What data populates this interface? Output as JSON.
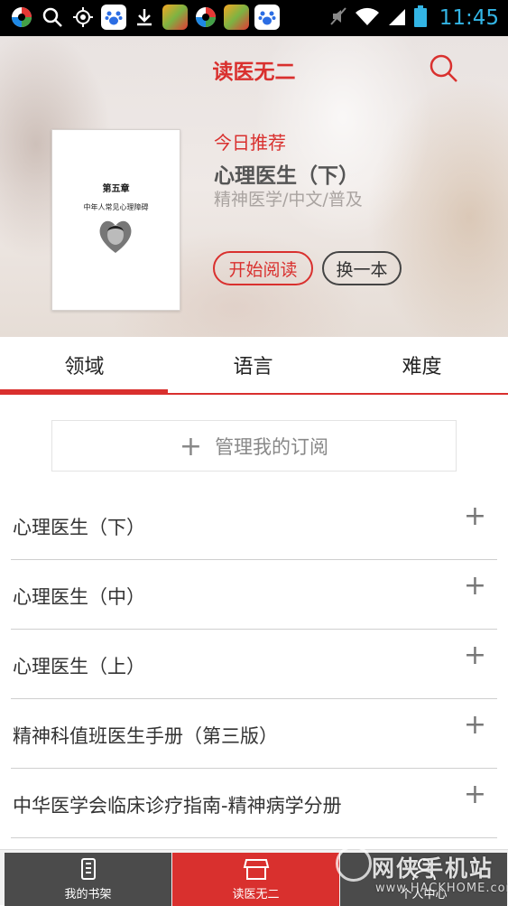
{
  "status_bar": {
    "time": "11:45",
    "icons": [
      "wandoujia-icon",
      "search-icon",
      "gps-icon",
      "baidu-icon",
      "download-icon",
      "game-icon",
      "wandoujia-icon",
      "game-icon",
      "baidu-icon",
      "mute-icon",
      "wifi-icon",
      "signal-icon",
      "battery-icon"
    ]
  },
  "header": {
    "title": "读医无二"
  },
  "recommend": {
    "label": "今日推荐",
    "book_title": "心理医生（下）",
    "book_meta": "精神医学/中文/普及",
    "read_button": "开始阅读",
    "change_button": "换一本",
    "cover": {
      "chapter": "第五章",
      "subtitle": "中年人常见心理障碍"
    }
  },
  "tabs": [
    {
      "label": "领域",
      "active": true
    },
    {
      "label": "语言",
      "active": false
    },
    {
      "label": "难度",
      "active": false
    }
  ],
  "manage": {
    "label": "管理我的订阅"
  },
  "list": [
    {
      "title": "心理医生（下）"
    },
    {
      "title": "心理医生（中）"
    },
    {
      "title": "心理医生（上）"
    },
    {
      "title": "精神科值班医生手册（第三版）"
    },
    {
      "title": "中华医学会临床诊疗指南-精神病学分册"
    }
  ],
  "bottom_nav": {
    "bookshelf": "我的书架",
    "home": "读医无二",
    "profile": "个人中心"
  },
  "colors": {
    "accent": "#d9302e",
    "nav_dark": "#4b4b4b",
    "status_time": "#33b5e5"
  },
  "watermark": {
    "text": "网侠手机站",
    "url": "www.HACKHOME.com"
  }
}
